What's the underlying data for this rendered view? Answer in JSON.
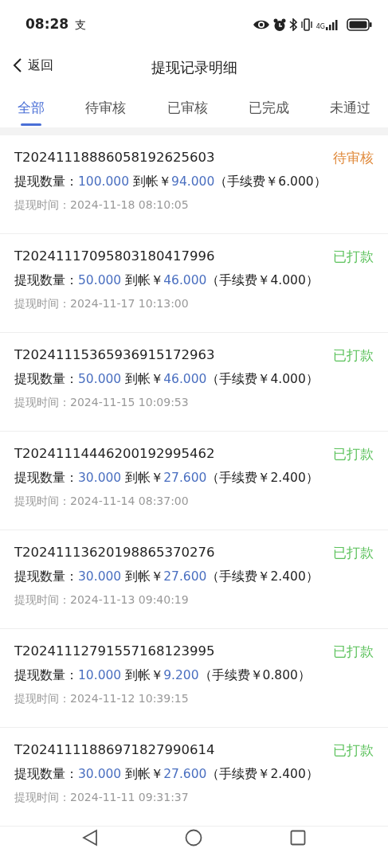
{
  "status_bar": {
    "time": "08:28",
    "carrier_glyph": "支",
    "network": "4G"
  },
  "header": {
    "back_label": "返回",
    "title": "提现记录明细"
  },
  "tabs": [
    {
      "label": "全部",
      "selected": true
    },
    {
      "label": "待审核",
      "selected": false
    },
    {
      "label": "已审核",
      "selected": false
    },
    {
      "label": "已完成",
      "selected": false
    },
    {
      "label": "未通过",
      "selected": false
    }
  ],
  "records": [
    {
      "id": "T20241118886058192625603",
      "status": {
        "text": "待审核",
        "color": "#e08a3c"
      },
      "quantity_label": "提现数量：",
      "quantity": "100.000",
      "received_label": "到帐￥",
      "received": "94.000",
      "fee": "（手续费￥6.000）",
      "time": "提现时间：2024-11-18 08:10:05"
    },
    {
      "id": "T20241117095803180417996",
      "status": {
        "text": "已打款",
        "color": "#5cc25c"
      },
      "quantity_label": "提现数量：",
      "quantity": "50.000",
      "received_label": "到帐￥",
      "received": "46.000",
      "fee": "（手续费￥4.000）",
      "time": "提现时间：2024-11-17 10:13:00"
    },
    {
      "id": "T20241115365936915172963",
      "status": {
        "text": "已打款",
        "color": "#5cc25c"
      },
      "quantity_label": "提现数量：",
      "quantity": "50.000",
      "received_label": "到帐￥",
      "received": "46.000",
      "fee": "（手续费￥4.000）",
      "time": "提现时间：2024-11-15 10:09:53"
    },
    {
      "id": "T20241114446200192995462",
      "status": {
        "text": "已打款",
        "color": "#5cc25c"
      },
      "quantity_label": "提现数量：",
      "quantity": "30.000",
      "received_label": "到帐￥",
      "received": "27.600",
      "fee": "（手续费￥2.400）",
      "time": "提现时间：2024-11-14 08:37:00"
    },
    {
      "id": "T20241113620198865370276",
      "status": {
        "text": "已打款",
        "color": "#5cc25c"
      },
      "quantity_label": "提现数量：",
      "quantity": "30.000",
      "received_label": "到帐￥",
      "received": "27.600",
      "fee": "（手续费￥2.400）",
      "time": "提现时间：2024-11-13 09:40:19"
    },
    {
      "id": "T20241112791557168123995",
      "status": {
        "text": "已打款",
        "color": "#5cc25c"
      },
      "quantity_label": "提现数量：",
      "quantity": "10.000",
      "received_label": "到帐￥",
      "received": "9.200",
      "fee": "（手续费￥0.800）",
      "time": "提现时间：2024-11-12 10:39:15"
    },
    {
      "id": "T20241111886971827990614",
      "status": {
        "text": "已打款",
        "color": "#5cc25c"
      },
      "quantity_label": "提现数量：",
      "quantity": "30.000",
      "received_label": "到帐￥",
      "received": "27.600",
      "fee": "（手续费￥2.400）",
      "time": "提现时间：2024-11-11 09:31:37"
    }
  ]
}
